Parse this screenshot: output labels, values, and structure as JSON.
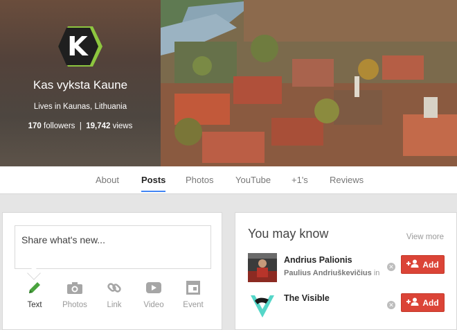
{
  "profile": {
    "name": "Kas vyksta Kaune",
    "location": "Lives in Kaunas, Lithuania",
    "followers_count": "170",
    "followers_label": "followers",
    "separator": "|",
    "views_count": "19,742",
    "views_label": "views",
    "logo_letter": "K"
  },
  "tabs": [
    {
      "label": "About",
      "active": false
    },
    {
      "label": "Posts",
      "active": true
    },
    {
      "label": "Photos",
      "active": false
    },
    {
      "label": "YouTube",
      "active": false
    },
    {
      "label": "+1's",
      "active": false
    },
    {
      "label": "Reviews",
      "active": false
    }
  ],
  "share": {
    "placeholder": "Share what's new...",
    "actions": [
      {
        "label": "Text",
        "icon": "pencil-icon",
        "selected": true
      },
      {
        "label": "Photos",
        "icon": "camera-icon",
        "selected": false
      },
      {
        "label": "Link",
        "icon": "link-icon",
        "selected": false
      },
      {
        "label": "Video",
        "icon": "youtube-icon",
        "selected": false
      },
      {
        "label": "Event",
        "icon": "calendar-icon",
        "selected": false
      }
    ]
  },
  "you_may_know": {
    "title": "You may know",
    "view_more": "View more",
    "people": [
      {
        "name": "Andrius Palionis",
        "mutual_name": "Paulius Andriuškevičius",
        "mutual_suffix": "in co",
        "add_label": "Add"
      },
      {
        "name": "The Visible",
        "mutual_name": "",
        "mutual_suffix": "",
        "add_label": "Add"
      }
    ]
  },
  "colors": {
    "accent_blue": "#4285f4",
    "add_red": "#db4437",
    "logo_green": "#8dc63f",
    "text_pencil_green": "#4aa33e",
    "visible_teal": "#55d6c8"
  }
}
